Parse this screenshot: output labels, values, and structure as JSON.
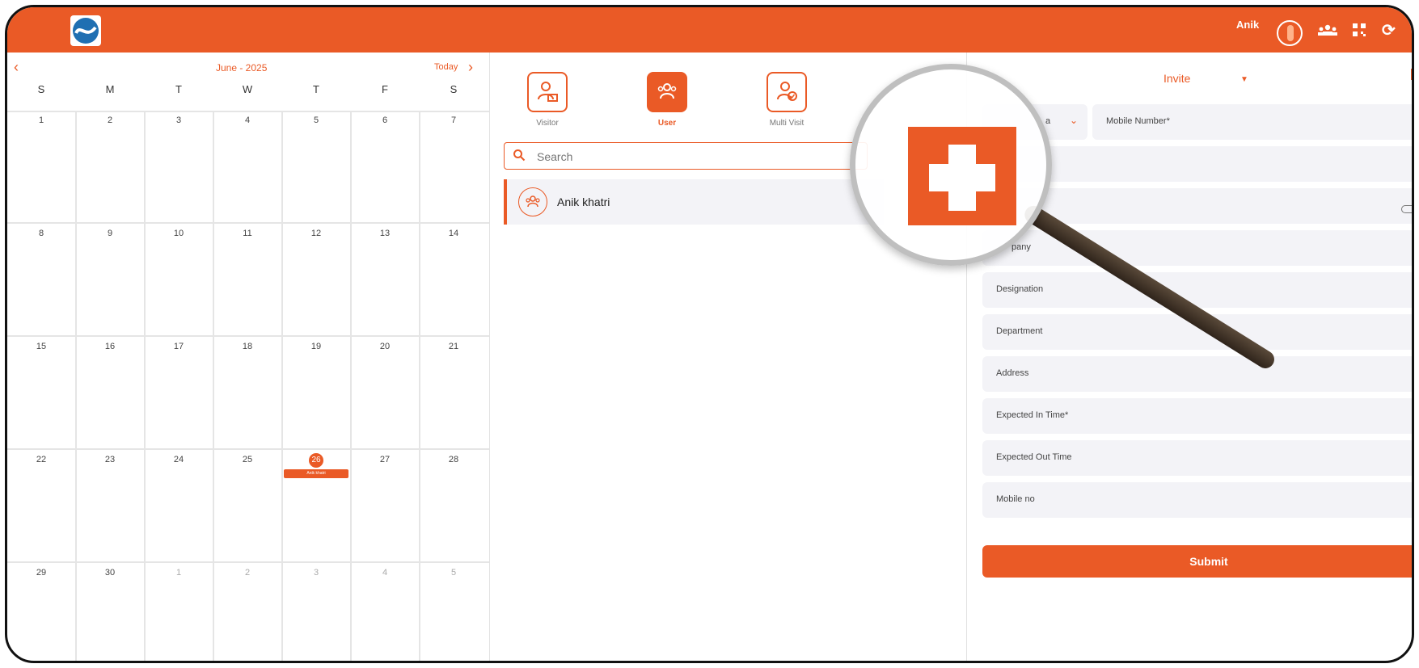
{
  "header": {
    "user_name": "Anik",
    "icons": [
      "app-logo",
      "avatar",
      "users-icon",
      "qr-icon",
      "refresh-icon"
    ]
  },
  "calendar": {
    "month_label": "June - 2025",
    "today_label": "Today",
    "weekdays": [
      "S",
      "M",
      "T",
      "W",
      "T",
      "F",
      "S"
    ],
    "weeks": [
      [
        "1",
        "2",
        "3",
        "4",
        "5",
        "6",
        "7"
      ],
      [
        "8",
        "9",
        "10",
        "11",
        "12",
        "13",
        "14"
      ],
      [
        "15",
        "16",
        "17",
        "18",
        "19",
        "20",
        "21"
      ],
      [
        "22",
        "23",
        "24",
        "25",
        "26",
        "27",
        "28"
      ],
      [
        "29",
        "30",
        "1",
        "2",
        "3",
        "4",
        "5"
      ]
    ],
    "selected_day": "26",
    "event_label": "Anik khatri"
  },
  "visitor_types": [
    {
      "label": "Visitor",
      "active": false
    },
    {
      "label": "User",
      "active": true
    },
    {
      "label": "Multi Visit",
      "active": false
    }
  ],
  "search": {
    "placeholder": "Search"
  },
  "list": [
    {
      "name": "Anik khatri"
    }
  ],
  "form": {
    "title": "Invite",
    "country_code_partial": "a",
    "fields": {
      "mobile_number": "Mobile Number*",
      "company": "Company",
      "company_visible": "pany",
      "designation": "Designation",
      "department": "Department",
      "address": "Address",
      "expected_in": "Expected In Time*",
      "expected_out": "Expected Out Time",
      "mobile_no": "Mobile no"
    },
    "submit_label": "Submit"
  },
  "colors": {
    "accent": "#ea5a26"
  }
}
